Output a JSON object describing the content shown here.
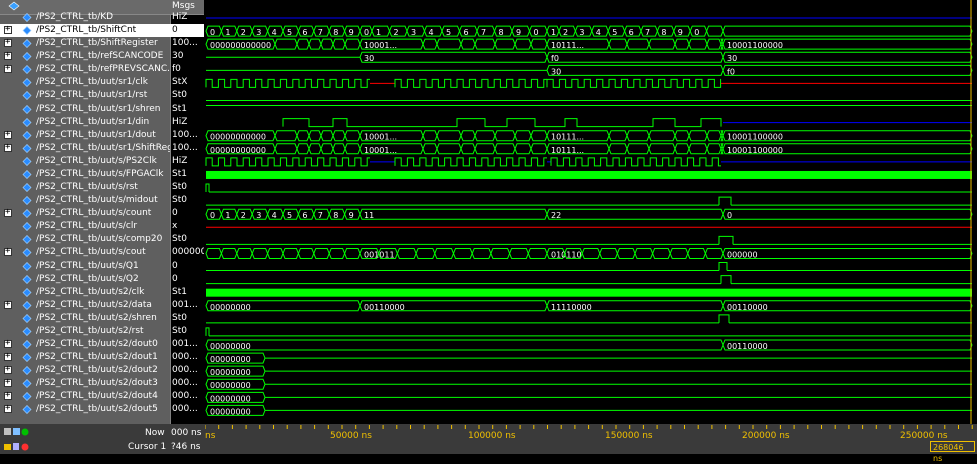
{
  "header": {
    "msgs_label": "Msgs"
  },
  "signals": [
    {
      "name": "/PS2_CTRL_tb/KD",
      "value": "HiZ"
    },
    {
      "name": "/PS2_CTRL_tb/ShiftCnt",
      "value": "0"
    },
    {
      "name": "/PS2_CTRL_tb/ShiftRegister",
      "value": "100..."
    },
    {
      "name": "/PS2_CTRL_tb/refSCANCODE",
      "value": "30"
    },
    {
      "name": "/PS2_CTRL_tb/refPREVSCANC...",
      "value": "f0"
    },
    {
      "name": "/PS2_CTRL_tb/uut/sr1/clk",
      "value": "StX"
    },
    {
      "name": "/PS2_CTRL_tb/uut/sr1/rst",
      "value": "St0"
    },
    {
      "name": "/PS2_CTRL_tb/uut/sr1/shren",
      "value": "St1"
    },
    {
      "name": "/PS2_CTRL_tb/uut/sr1/din",
      "value": "HiZ"
    },
    {
      "name": "/PS2_CTRL_tb/uut/sr1/dout",
      "value": "100..."
    },
    {
      "name": "/PS2_CTRL_tb/uut/sr1/ShiftReg...",
      "value": "100..."
    },
    {
      "name": "/PS2_CTRL_tb/uut/s/PS2Clk",
      "value": "HiZ"
    },
    {
      "name": "/PS2_CTRL_tb/uut/s/FPGAClk",
      "value": "St1"
    },
    {
      "name": "/PS2_CTRL_tb/uut/s/rst",
      "value": "St0"
    },
    {
      "name": "/PS2_CTRL_tb/uut/s/midout",
      "value": "St0"
    },
    {
      "name": "/PS2_CTRL_tb/uut/s/count",
      "value": "0"
    },
    {
      "name": "/PS2_CTRL_tb/uut/s/clr",
      "value": "x"
    },
    {
      "name": "/PS2_CTRL_tb/uut/s/comp20",
      "value": "St0"
    },
    {
      "name": "/PS2_CTRL_tb/uut/s/cout",
      "value": "000000"
    },
    {
      "name": "/PS2_CTRL_tb/uut/s/Q1",
      "value": "0"
    },
    {
      "name": "/PS2_CTRL_tb/uut/s/Q2",
      "value": "0"
    },
    {
      "name": "/PS2_CTRL_tb/uut/s2/clk",
      "value": "St1"
    },
    {
      "name": "/PS2_CTRL_tb/uut/s2/data",
      "value": "001..."
    },
    {
      "name": "/PS2_CTRL_tb/uut/s2/shren",
      "value": "St0"
    },
    {
      "name": "/PS2_CTRL_tb/uut/s2/rst",
      "value": "St0"
    },
    {
      "name": "/PS2_CTRL_tb/uut/s2/dout0",
      "value": "001..."
    },
    {
      "name": "/PS2_CTRL_tb/uut/s2/dout1",
      "value": "000..."
    },
    {
      "name": "/PS2_CTRL_tb/uut/s2/dout2",
      "value": "000..."
    },
    {
      "name": "/PS2_CTRL_tb/uut/s2/dout3",
      "value": "000..."
    },
    {
      "name": "/PS2_CTRL_tb/uut/s2/dout4",
      "value": "000..."
    },
    {
      "name": "/PS2_CTRL_tb/uut/s2/dout5",
      "value": "000..."
    }
  ],
  "bus_labels": {
    "shiftcnt": [
      "0",
      "1",
      "2",
      "3",
      "4",
      "5",
      "6",
      "7",
      "8",
      "9",
      "0",
      "1",
      "2",
      "3",
      "4",
      "5",
      "6",
      "7",
      "8",
      "9",
      "0",
      "1",
      "2",
      "3",
      "4",
      "5",
      "6",
      "7",
      "8",
      "9",
      "0"
    ],
    "shiftreg": [
      "000000000000",
      "10001...",
      "10111...",
      "10001100000"
    ],
    "refscan": [
      "30",
      "f0",
      "30"
    ],
    "refprev": [
      "30",
      "f0"
    ],
    "dout": [
      "00000000000",
      "10001...",
      "10111...",
      "10001100000"
    ],
    "shiftreg2": [
      "00000000000",
      "10001...",
      "10111...",
      "10001100000"
    ],
    "count": [
      "0",
      "1",
      "2",
      "3",
      "4",
      "5",
      "6",
      "7",
      "8",
      "9",
      "11",
      "22",
      "0"
    ],
    "cout": [
      "001011",
      "010110",
      "000000"
    ],
    "data": [
      "00000000",
      "00110000",
      "11110000",
      "00110000"
    ],
    "dout0": [
      "00000000",
      "00110000"
    ],
    "dout1": [
      "00000000"
    ],
    "dout2": [
      "00000000"
    ],
    "dout3": [
      "00000000"
    ],
    "dout4": [
      "00000000"
    ],
    "dout5": [
      "00000000"
    ]
  },
  "footer": {
    "now_label": "Now",
    "now_value": "000 ns",
    "cursor_label": "Cursor 1",
    "cursor_value": "?46 ns",
    "ticks": [
      "ns",
      "50000 ns",
      "100000 ns",
      "150000 ns",
      "200000 ns",
      "250000 ns"
    ],
    "cursor_readout": "268046 ns"
  },
  "colors": {
    "wave_green": "#00ff00",
    "bus_text": "#ffffff",
    "hiz_blue": "#0000ff",
    "red": "#ff0000",
    "cursor_yellow": "#f0c000",
    "panel_gray": "#5f5f5f"
  }
}
